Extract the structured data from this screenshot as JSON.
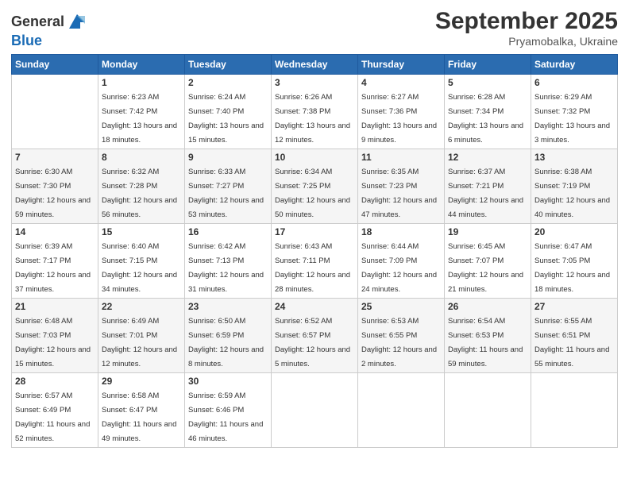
{
  "header": {
    "logo_line1": "General",
    "logo_line2": "Blue",
    "month": "September 2025",
    "location": "Pryamobalka, Ukraine"
  },
  "days_of_week": [
    "Sunday",
    "Monday",
    "Tuesday",
    "Wednesday",
    "Thursday",
    "Friday",
    "Saturday"
  ],
  "weeks": [
    [
      {
        "num": "",
        "sunrise": "",
        "sunset": "",
        "daylight": ""
      },
      {
        "num": "1",
        "sunrise": "Sunrise: 6:23 AM",
        "sunset": "Sunset: 7:42 PM",
        "daylight": "Daylight: 13 hours and 18 minutes."
      },
      {
        "num": "2",
        "sunrise": "Sunrise: 6:24 AM",
        "sunset": "Sunset: 7:40 PM",
        "daylight": "Daylight: 13 hours and 15 minutes."
      },
      {
        "num": "3",
        "sunrise": "Sunrise: 6:26 AM",
        "sunset": "Sunset: 7:38 PM",
        "daylight": "Daylight: 13 hours and 12 minutes."
      },
      {
        "num": "4",
        "sunrise": "Sunrise: 6:27 AM",
        "sunset": "Sunset: 7:36 PM",
        "daylight": "Daylight: 13 hours and 9 minutes."
      },
      {
        "num": "5",
        "sunrise": "Sunrise: 6:28 AM",
        "sunset": "Sunset: 7:34 PM",
        "daylight": "Daylight: 13 hours and 6 minutes."
      },
      {
        "num": "6",
        "sunrise": "Sunrise: 6:29 AM",
        "sunset": "Sunset: 7:32 PM",
        "daylight": "Daylight: 13 hours and 3 minutes."
      }
    ],
    [
      {
        "num": "7",
        "sunrise": "Sunrise: 6:30 AM",
        "sunset": "Sunset: 7:30 PM",
        "daylight": "Daylight: 12 hours and 59 minutes."
      },
      {
        "num": "8",
        "sunrise": "Sunrise: 6:32 AM",
        "sunset": "Sunset: 7:28 PM",
        "daylight": "Daylight: 12 hours and 56 minutes."
      },
      {
        "num": "9",
        "sunrise": "Sunrise: 6:33 AM",
        "sunset": "Sunset: 7:27 PM",
        "daylight": "Daylight: 12 hours and 53 minutes."
      },
      {
        "num": "10",
        "sunrise": "Sunrise: 6:34 AM",
        "sunset": "Sunset: 7:25 PM",
        "daylight": "Daylight: 12 hours and 50 minutes."
      },
      {
        "num": "11",
        "sunrise": "Sunrise: 6:35 AM",
        "sunset": "Sunset: 7:23 PM",
        "daylight": "Daylight: 12 hours and 47 minutes."
      },
      {
        "num": "12",
        "sunrise": "Sunrise: 6:37 AM",
        "sunset": "Sunset: 7:21 PM",
        "daylight": "Daylight: 12 hours and 44 minutes."
      },
      {
        "num": "13",
        "sunrise": "Sunrise: 6:38 AM",
        "sunset": "Sunset: 7:19 PM",
        "daylight": "Daylight: 12 hours and 40 minutes."
      }
    ],
    [
      {
        "num": "14",
        "sunrise": "Sunrise: 6:39 AM",
        "sunset": "Sunset: 7:17 PM",
        "daylight": "Daylight: 12 hours and 37 minutes."
      },
      {
        "num": "15",
        "sunrise": "Sunrise: 6:40 AM",
        "sunset": "Sunset: 7:15 PM",
        "daylight": "Daylight: 12 hours and 34 minutes."
      },
      {
        "num": "16",
        "sunrise": "Sunrise: 6:42 AM",
        "sunset": "Sunset: 7:13 PM",
        "daylight": "Daylight: 12 hours and 31 minutes."
      },
      {
        "num": "17",
        "sunrise": "Sunrise: 6:43 AM",
        "sunset": "Sunset: 7:11 PM",
        "daylight": "Daylight: 12 hours and 28 minutes."
      },
      {
        "num": "18",
        "sunrise": "Sunrise: 6:44 AM",
        "sunset": "Sunset: 7:09 PM",
        "daylight": "Daylight: 12 hours and 24 minutes."
      },
      {
        "num": "19",
        "sunrise": "Sunrise: 6:45 AM",
        "sunset": "Sunset: 7:07 PM",
        "daylight": "Daylight: 12 hours and 21 minutes."
      },
      {
        "num": "20",
        "sunrise": "Sunrise: 6:47 AM",
        "sunset": "Sunset: 7:05 PM",
        "daylight": "Daylight: 12 hours and 18 minutes."
      }
    ],
    [
      {
        "num": "21",
        "sunrise": "Sunrise: 6:48 AM",
        "sunset": "Sunset: 7:03 PM",
        "daylight": "Daylight: 12 hours and 15 minutes."
      },
      {
        "num": "22",
        "sunrise": "Sunrise: 6:49 AM",
        "sunset": "Sunset: 7:01 PM",
        "daylight": "Daylight: 12 hours and 12 minutes."
      },
      {
        "num": "23",
        "sunrise": "Sunrise: 6:50 AM",
        "sunset": "Sunset: 6:59 PM",
        "daylight": "Daylight: 12 hours and 8 minutes."
      },
      {
        "num": "24",
        "sunrise": "Sunrise: 6:52 AM",
        "sunset": "Sunset: 6:57 PM",
        "daylight": "Daylight: 12 hours and 5 minutes."
      },
      {
        "num": "25",
        "sunrise": "Sunrise: 6:53 AM",
        "sunset": "Sunset: 6:55 PM",
        "daylight": "Daylight: 12 hours and 2 minutes."
      },
      {
        "num": "26",
        "sunrise": "Sunrise: 6:54 AM",
        "sunset": "Sunset: 6:53 PM",
        "daylight": "Daylight: 11 hours and 59 minutes."
      },
      {
        "num": "27",
        "sunrise": "Sunrise: 6:55 AM",
        "sunset": "Sunset: 6:51 PM",
        "daylight": "Daylight: 11 hours and 55 minutes."
      }
    ],
    [
      {
        "num": "28",
        "sunrise": "Sunrise: 6:57 AM",
        "sunset": "Sunset: 6:49 PM",
        "daylight": "Daylight: 11 hours and 52 minutes."
      },
      {
        "num": "29",
        "sunrise": "Sunrise: 6:58 AM",
        "sunset": "Sunset: 6:47 PM",
        "daylight": "Daylight: 11 hours and 49 minutes."
      },
      {
        "num": "30",
        "sunrise": "Sunrise: 6:59 AM",
        "sunset": "Sunset: 6:46 PM",
        "daylight": "Daylight: 11 hours and 46 minutes."
      },
      {
        "num": "",
        "sunrise": "",
        "sunset": "",
        "daylight": ""
      },
      {
        "num": "",
        "sunrise": "",
        "sunset": "",
        "daylight": ""
      },
      {
        "num": "",
        "sunrise": "",
        "sunset": "",
        "daylight": ""
      },
      {
        "num": "",
        "sunrise": "",
        "sunset": "",
        "daylight": ""
      }
    ]
  ]
}
